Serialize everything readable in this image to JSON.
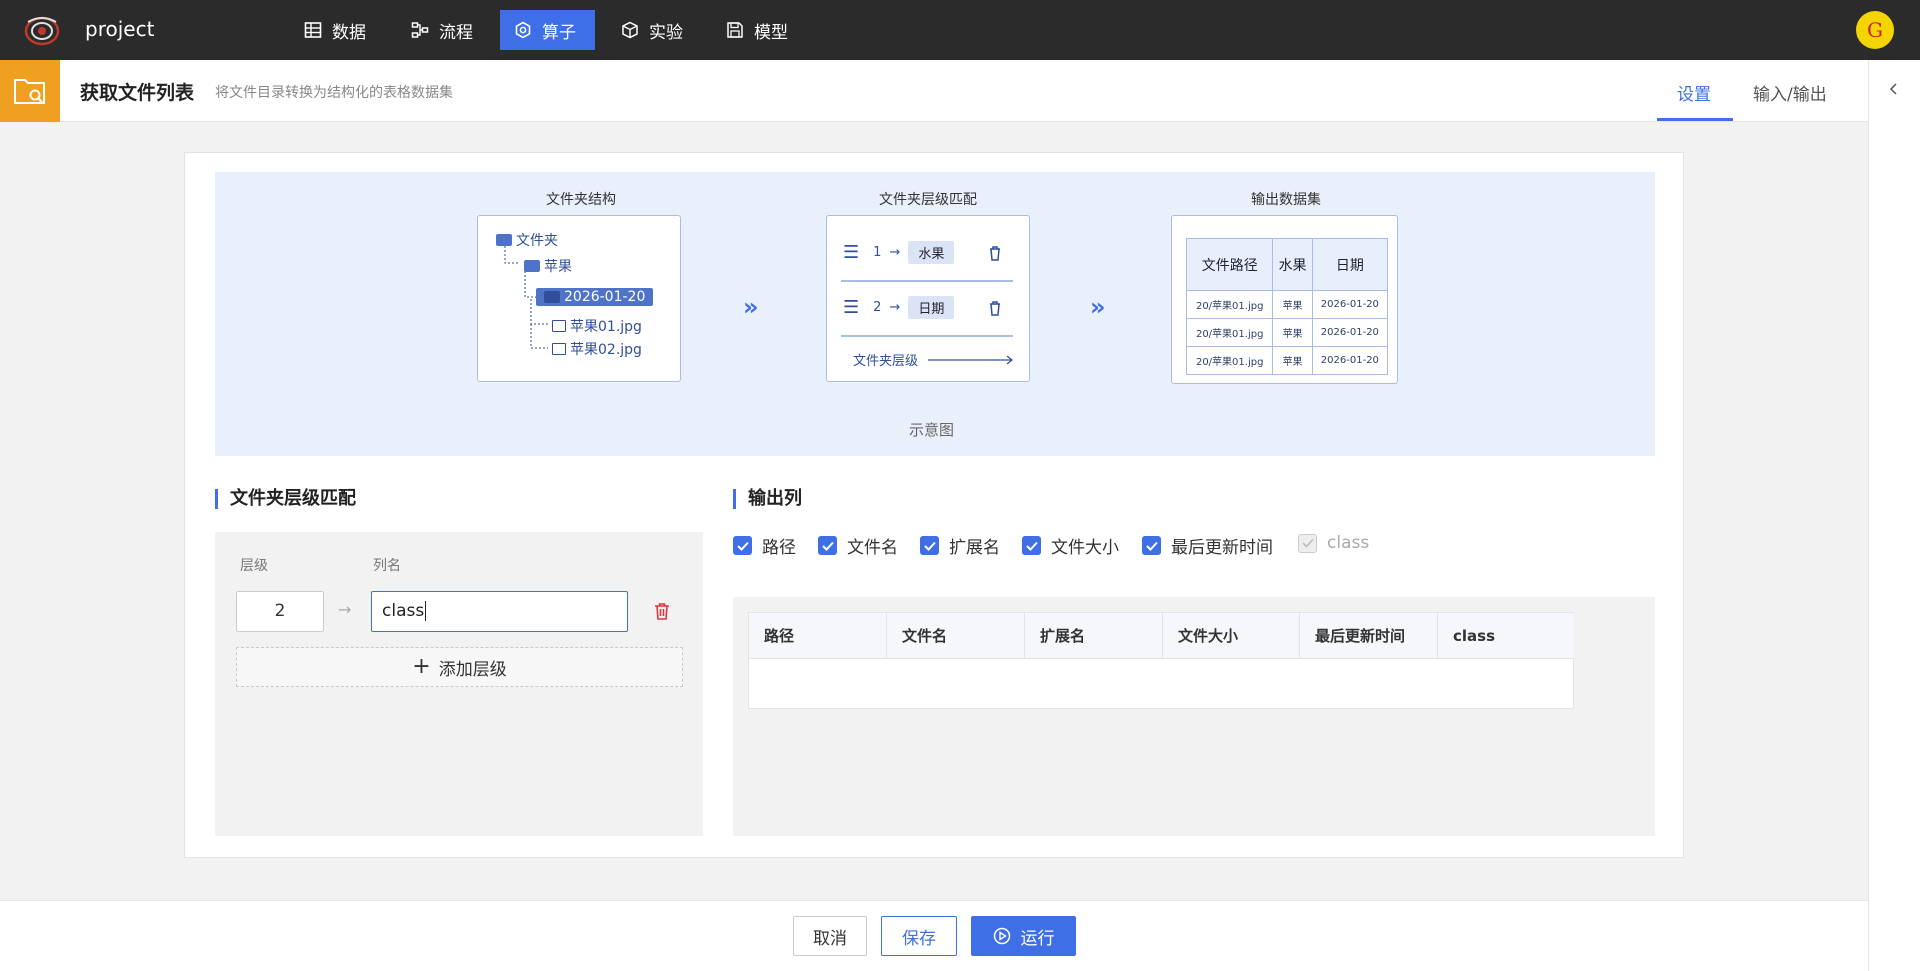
{
  "app": {
    "project": "project",
    "avatar_letter": "G"
  },
  "nav": [
    {
      "label": "数据",
      "icon": "table-icon"
    },
    {
      "label": "流程",
      "icon": "flow-icon"
    },
    {
      "label": "算子",
      "icon": "hexagon-icon",
      "active": true
    },
    {
      "label": "实验",
      "icon": "cube-icon"
    },
    {
      "label": "模型",
      "icon": "save-icon"
    }
  ],
  "header": {
    "title": "获取文件列表",
    "description": "将文件目录转换为结构化的表格数据集",
    "tabs": [
      "设置",
      "输入/输出"
    ]
  },
  "diagram": {
    "panels": [
      "文件夹结构",
      "文件夹层级匹配",
      "输出数据集"
    ],
    "tree": [
      "文件夹",
      "苹果",
      "2026-01-20",
      "苹果01.jpg",
      "苹果02.jpg"
    ],
    "mapping": [
      {
        "level": "1",
        "name": "水果"
      },
      {
        "level": "2",
        "name": "日期"
      }
    ],
    "mapping_footer": "文件夹层级",
    "table_headers": [
      "文件路径",
      "水果",
      "日期"
    ],
    "table_rows": [
      [
        "20/苹果01.jpg",
        "苹果",
        "2026-01-20"
      ],
      [
        "20/苹果01.jpg",
        "苹果",
        "2026-01-20"
      ],
      [
        "20/苹果01.jpg",
        "苹果",
        "2026-01-20"
      ]
    ],
    "caption": "示意图"
  },
  "level_match": {
    "title": "文件夹层级匹配",
    "level_label": "层级",
    "name_label": "列名",
    "level_value": "2",
    "name_value": "class",
    "add_label": "添加层级"
  },
  "output_columns": {
    "title": "输出列",
    "checks": [
      {
        "label": "路径",
        "checked": true
      },
      {
        "label": "文件名",
        "checked": true
      },
      {
        "label": "扩展名",
        "checked": true
      },
      {
        "label": "文件大小",
        "checked": true
      },
      {
        "label": "最后更新时间",
        "checked": true
      },
      {
        "label": "class",
        "checked": true,
        "disabled": true
      }
    ],
    "table_headers": [
      "路径",
      "文件名",
      "扩展名",
      "文件大小",
      "最后更新时间",
      "class"
    ]
  },
  "footer": {
    "cancel": "取消",
    "save": "保存",
    "run": "运行"
  },
  "colors": {
    "accent": "#3f6fe6",
    "header_icon": "#f0a020",
    "topbar": "#2b2b2b",
    "danger": "#d9363e"
  }
}
